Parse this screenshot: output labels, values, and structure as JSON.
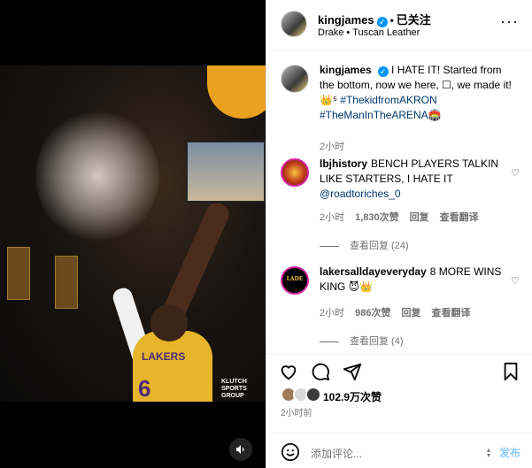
{
  "post": {
    "username": "kingjames",
    "follow_state": "已关注",
    "separator": "•",
    "music_artist": "Drake",
    "music_title": "Tuscan Leather",
    "music_separator": "•",
    "more_icon": "more-horizontal-icon"
  },
  "caption": {
    "username": "kingjames",
    "text": "I HATE IT! Started from the bottom, now we here, ☐, we made it! 👑⁵",
    "hashtag1": "#ThekidfromAKRON",
    "hashtag2": "#TheManInTheARENA",
    "emoji_after": "🏟️",
    "time": "2小时"
  },
  "comments": [
    {
      "username": "lbjhistory",
      "text": "BENCH PLAYERS TALKIN LIKE STARTERS, I HATE IT",
      "mention": "@roadtoriches_0",
      "time": "2小时",
      "likes": "1,830次赞",
      "reply": "回复",
      "translate": "查看翻译",
      "view_replies": "查看回复 (24)"
    },
    {
      "username": "lakersalldayeveryday",
      "text": "8 MORE WINS KING 😈👑",
      "avatar_text": "LADE",
      "time": "2小时",
      "likes": "986次赞",
      "reply": "回复",
      "translate": "查看翻译",
      "view_replies": "查看回复 (4)"
    }
  ],
  "likes_summary": {
    "count": "102.9万次赞",
    "time_ago": "2小时前"
  },
  "composer": {
    "placeholder": "添加评论...",
    "post_label": "发布"
  },
  "media": {
    "jersey_team": "LAKERS",
    "jersey_number": "6",
    "watermark": "KLUTCH SPORTS GROUP"
  },
  "colors": {
    "verified": "#0095f6",
    "link": "#00376b",
    "post_disabled": "#8fcdfb",
    "meta": "#737373"
  }
}
